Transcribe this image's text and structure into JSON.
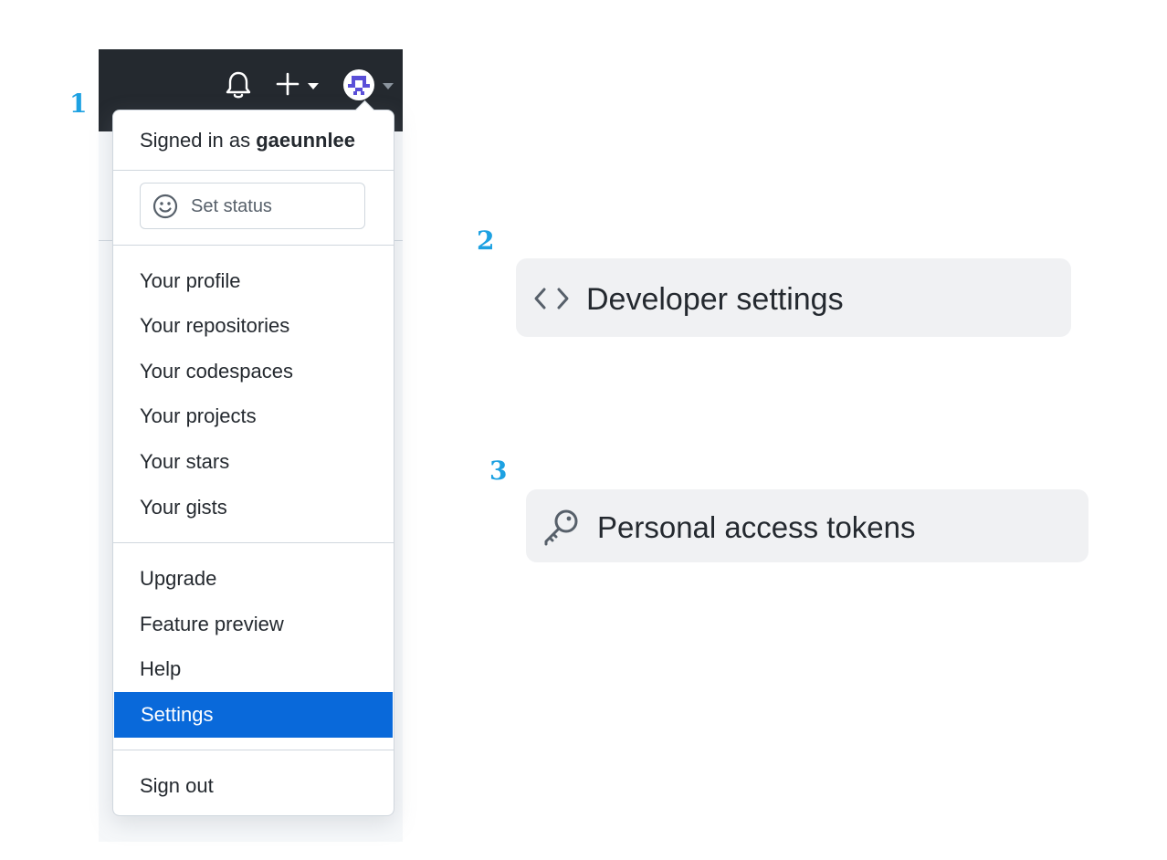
{
  "steps": {
    "one": "1",
    "two": "2",
    "three": "3"
  },
  "header": {
    "icons": [
      "bell-icon",
      "plus-icon",
      "caret-down-icon",
      "avatar",
      "caret-down-icon"
    ]
  },
  "menu": {
    "signed_in_prefix": "Signed in as",
    "username": "gaeunnlee",
    "set_status": "Set status",
    "profile_items": [
      "Your profile",
      "Your repositories",
      "Your codespaces",
      "Your projects",
      "Your stars",
      "Your gists"
    ],
    "account_items": [
      "Upgrade",
      "Feature preview",
      "Help",
      "Settings"
    ],
    "sign_out": "Sign out",
    "active_item": "Settings",
    "active_color": "#0969da"
  },
  "developer_settings": {
    "label": "Developer settings",
    "icon": "code-icon"
  },
  "personal_access_tokens": {
    "label": "Personal access tokens",
    "icon": "key-icon"
  },
  "colors": {
    "step_number": "#1da1e2",
    "header_bg": "#24292f",
    "pill_bg": "#f0f1f3"
  }
}
